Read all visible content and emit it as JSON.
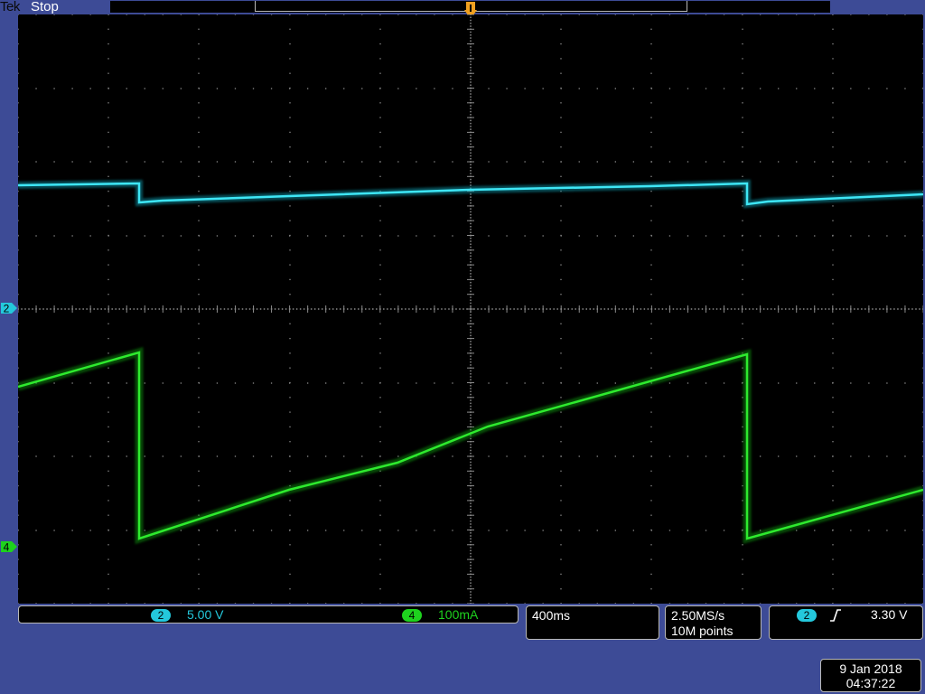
{
  "header": {
    "brand": "Tek",
    "status": "Stop"
  },
  "channels": [
    {
      "id": "2",
      "scale": "5.00 V",
      "color": "#24c8dc"
    },
    {
      "id": "4",
      "scale": "100mA",
      "color": "#1ed21e"
    }
  ],
  "horizontal": {
    "timebase": "400ms"
  },
  "acquisition": {
    "sample_rate": "2.50MS/s",
    "record_length": "10M points"
  },
  "trigger": {
    "source": "2",
    "slope_icon": "rising-edge-icon",
    "level": "3.30 V"
  },
  "datetime": {
    "date": "9 Jan 2018",
    "time": "04:37:22"
  },
  "colors": {
    "background": "#3d4b96",
    "graticule": "#8c8c8c",
    "trigger_marker": "#f0a020"
  }
}
